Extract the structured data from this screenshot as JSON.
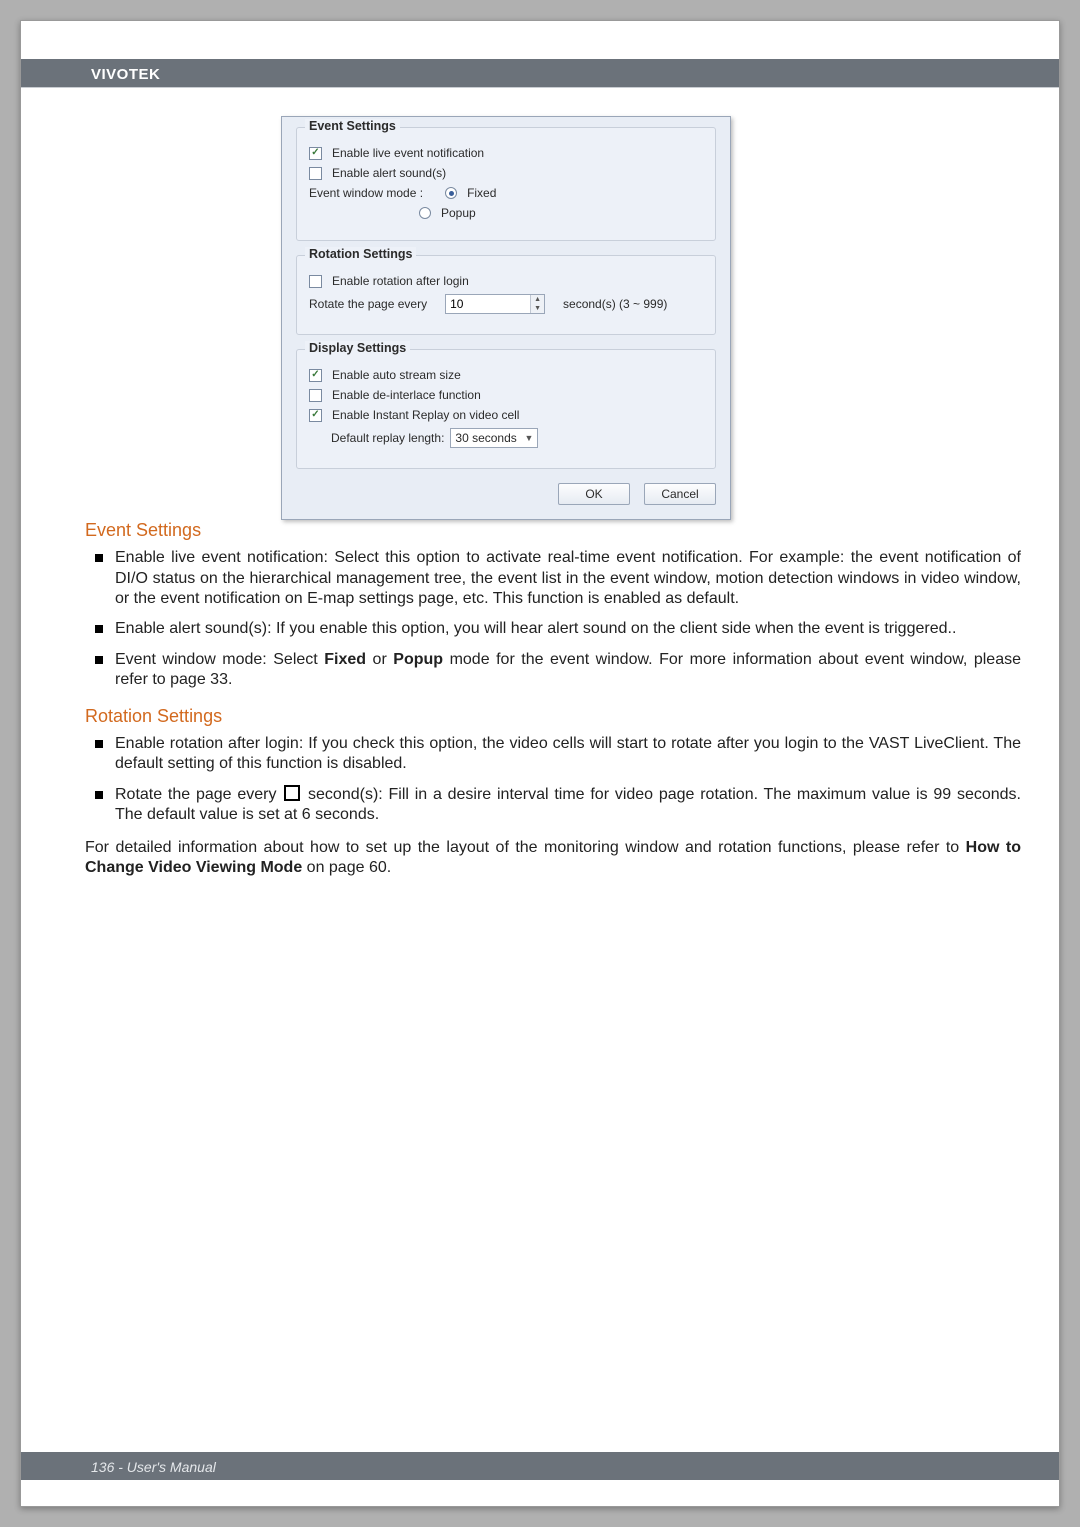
{
  "brand": "VIVOTEK",
  "dialog": {
    "event": {
      "title": "Event Settings",
      "live_notification": "Enable live event notification",
      "alert_sound": "Enable alert sound(s)",
      "window_mode_label": "Event window mode :",
      "fixed": "Fixed",
      "popup": "Popup"
    },
    "rotation": {
      "title": "Rotation Settings",
      "after_login": "Enable rotation after login",
      "rotate_label": "Rotate the page every",
      "rotate_value": "10",
      "rotate_suffix": "second(s)   (3 ~ 999)"
    },
    "display": {
      "title": "Display Settings",
      "auto_stream": "Enable auto stream size",
      "deinterlace": "Enable de-interlace function",
      "instant_replay": "Enable Instant Replay on video cell",
      "replay_label": "Default replay length:",
      "replay_value": "30 seconds"
    },
    "ok": "OK",
    "cancel": "Cancel"
  },
  "doc": {
    "event_title": "Event Settings",
    "event_b1": "Enable live event notification: Select this option to activate real-time event notification. For example: the event notification of DI/O status on the hierarchical management tree, the event list in the event window, motion detection windows in video window, or the event notification on E-map settings page, etc. This function is enabled as default.",
    "event_b2": "Enable alert sound(s): If you enable this option, you will hear alert sound on the client side when the event is triggered..",
    "event_b3a": "Event window mode: Select ",
    "event_b3_fixed": "Fixed",
    "event_b3_or": " or ",
    "event_b3_popup": "Popup",
    "event_b3b": " mode for the event window. For more information about event window, please refer to page 33.",
    "rotation_title": "Rotation Settings",
    "rot_b1": "Enable rotation after login: If you check this option, the video cells will start to rotate after you login to the VAST LiveClient. The default setting of this function is disabled.",
    "rot_b2a": "Rotate the page every ",
    "rot_b2b": " second(s): Fill in a desire interval time for video page rotation. The maximum value is 99 seconds. The default value is set at 6 seconds.",
    "para_a": "For detailed information about how to set up the layout of the monitoring window and rotation functions, please refer to ",
    "para_b_bold": "How to Change Video Viewing Mode",
    "para_c": " on page 60."
  },
  "footer": "136 - User's Manual"
}
